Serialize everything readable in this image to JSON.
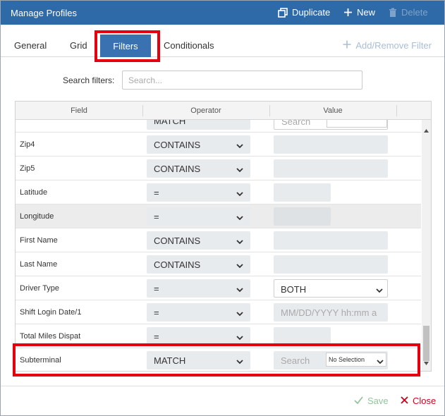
{
  "header": {
    "title": "Manage Profiles",
    "duplicate_label": "Duplicate",
    "new_label": "New",
    "delete_label": "Delete"
  },
  "tabs": {
    "general": "General",
    "grid": "Grid",
    "filters": "Filters",
    "conditionals": "Conditionals",
    "active": "Filters"
  },
  "add_remove_filter_label": "Add/Remove Filter",
  "search": {
    "label": "Search filters:",
    "placeholder": "Search...",
    "value": ""
  },
  "grid": {
    "columns": [
      "Field",
      "Operator",
      "Value"
    ],
    "partial_top_row": {
      "operator": "MATCH",
      "value_placeholder": "Search"
    },
    "rows": [
      {
        "field": "Zip4",
        "operator": "CONTAINS",
        "value": ""
      },
      {
        "field": "Zip5",
        "operator": "CONTAINS",
        "value": ""
      },
      {
        "field": "Latitude",
        "operator": "=",
        "value": ""
      },
      {
        "field": "Longitude",
        "operator": "=",
        "value": ""
      },
      {
        "field": "First Name",
        "operator": "CONTAINS",
        "value": ""
      },
      {
        "field": "Last Name",
        "operator": "CONTAINS",
        "value": ""
      },
      {
        "field": "Driver Type",
        "operator": "=",
        "value": "BOTH"
      },
      {
        "field": "Shift Login Date/1",
        "operator": "=",
        "value_placeholder": "MM/DD/YYYY hh:mm a"
      },
      {
        "field": "Total Miles Dispat",
        "operator": "=",
        "value": ""
      },
      {
        "field": "Subterminal",
        "operator": "MATCH",
        "value_placeholder": "Search",
        "selection": "No Selection"
      }
    ]
  },
  "footer": {
    "save_label": "Save",
    "close_label": "Close"
  },
  "colors": {
    "header_bg": "#2f6aa8",
    "tab_active_bg": "#3a72b1",
    "highlight": "#e4000f",
    "save": "#93c49b",
    "close": "#d0021b"
  }
}
